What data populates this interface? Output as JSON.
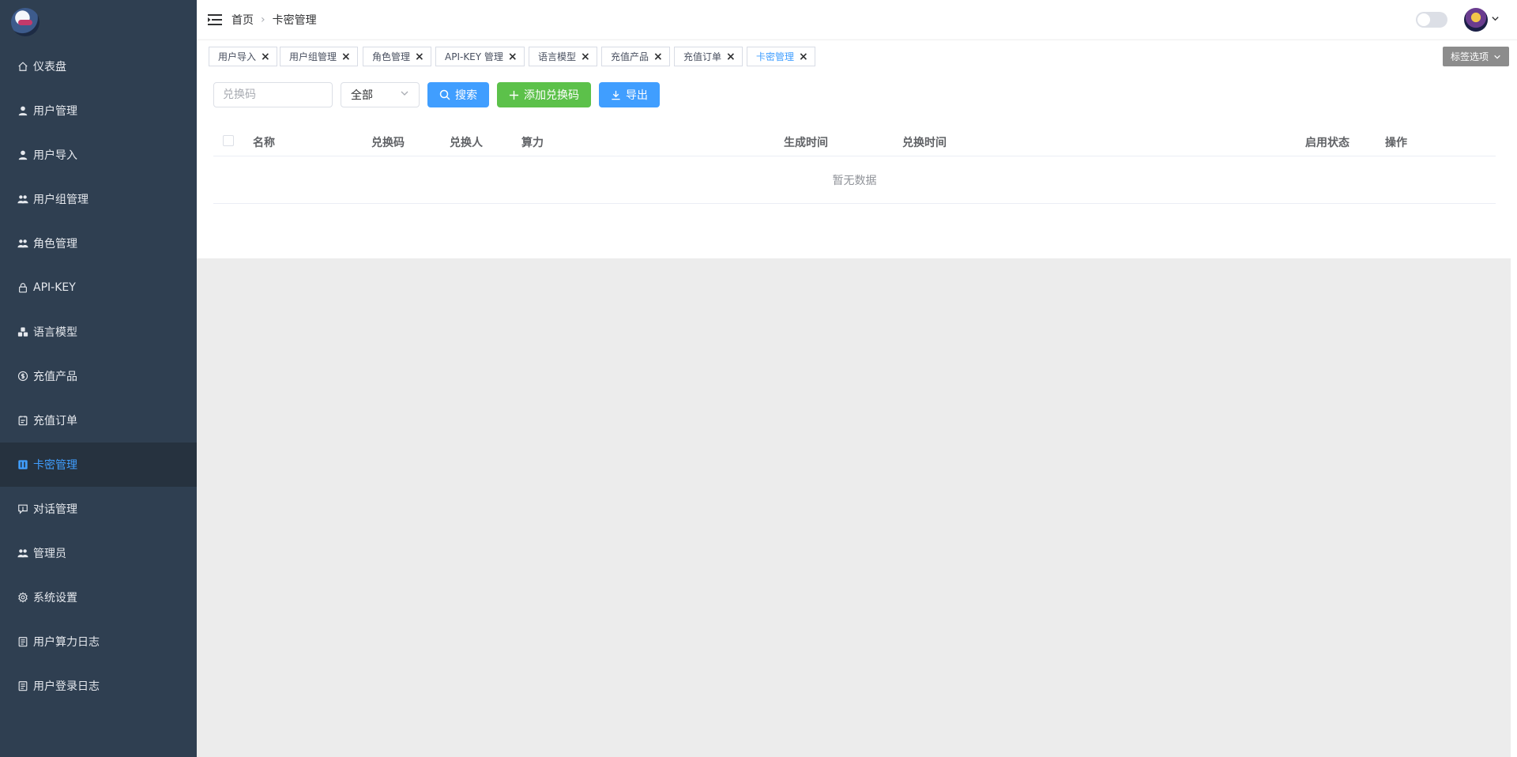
{
  "sidebar": {
    "items": [
      {
        "label": "仪表盘",
        "icon": "home-icon"
      },
      {
        "label": "用户管理",
        "icon": "user-icon"
      },
      {
        "label": "用户导入",
        "icon": "user-icon"
      },
      {
        "label": "用户组管理",
        "icon": "users-icon"
      },
      {
        "label": "角色管理",
        "icon": "users-icon"
      },
      {
        "label": "API-KEY",
        "icon": "lock-icon"
      },
      {
        "label": "语言模型",
        "icon": "cubes-icon"
      },
      {
        "label": "充值产品",
        "icon": "dollar-icon"
      },
      {
        "label": "充值订单",
        "icon": "order-icon"
      },
      {
        "label": "卡密管理",
        "icon": "card-icon"
      },
      {
        "label": "对话管理",
        "icon": "chat-icon"
      },
      {
        "label": "管理员",
        "icon": "users-icon"
      },
      {
        "label": "系统设置",
        "icon": "gear-icon"
      },
      {
        "label": "用户算力日志",
        "icon": "log-icon"
      },
      {
        "label": "用户登录日志",
        "icon": "log-icon"
      }
    ],
    "active_index": 9,
    "colors": {
      "background": "#2f3f51",
      "active_bg": "#26323f",
      "active_text": "#409eff"
    }
  },
  "header": {
    "breadcrumb": {
      "home": "首页",
      "current": "卡密管理"
    }
  },
  "tags": {
    "items": [
      "用户导入",
      "用户组管理",
      "角色管理",
      "API-KEY 管理",
      "语言模型",
      "充值产品",
      "充值订单",
      "卡密管理"
    ],
    "active_index": 7,
    "options_label": "标签选项"
  },
  "toolbar": {
    "search_placeholder": "兑换码",
    "select_value": "全部",
    "search_label": "搜索",
    "add_label": "添加兑换码",
    "export_label": "导出"
  },
  "table": {
    "columns": [
      "名称",
      "兑换码",
      "兑换人",
      "算力",
      "生成时间",
      "兑换时间",
      "启用状态",
      "操作"
    ],
    "empty_text": "暂无数据"
  }
}
